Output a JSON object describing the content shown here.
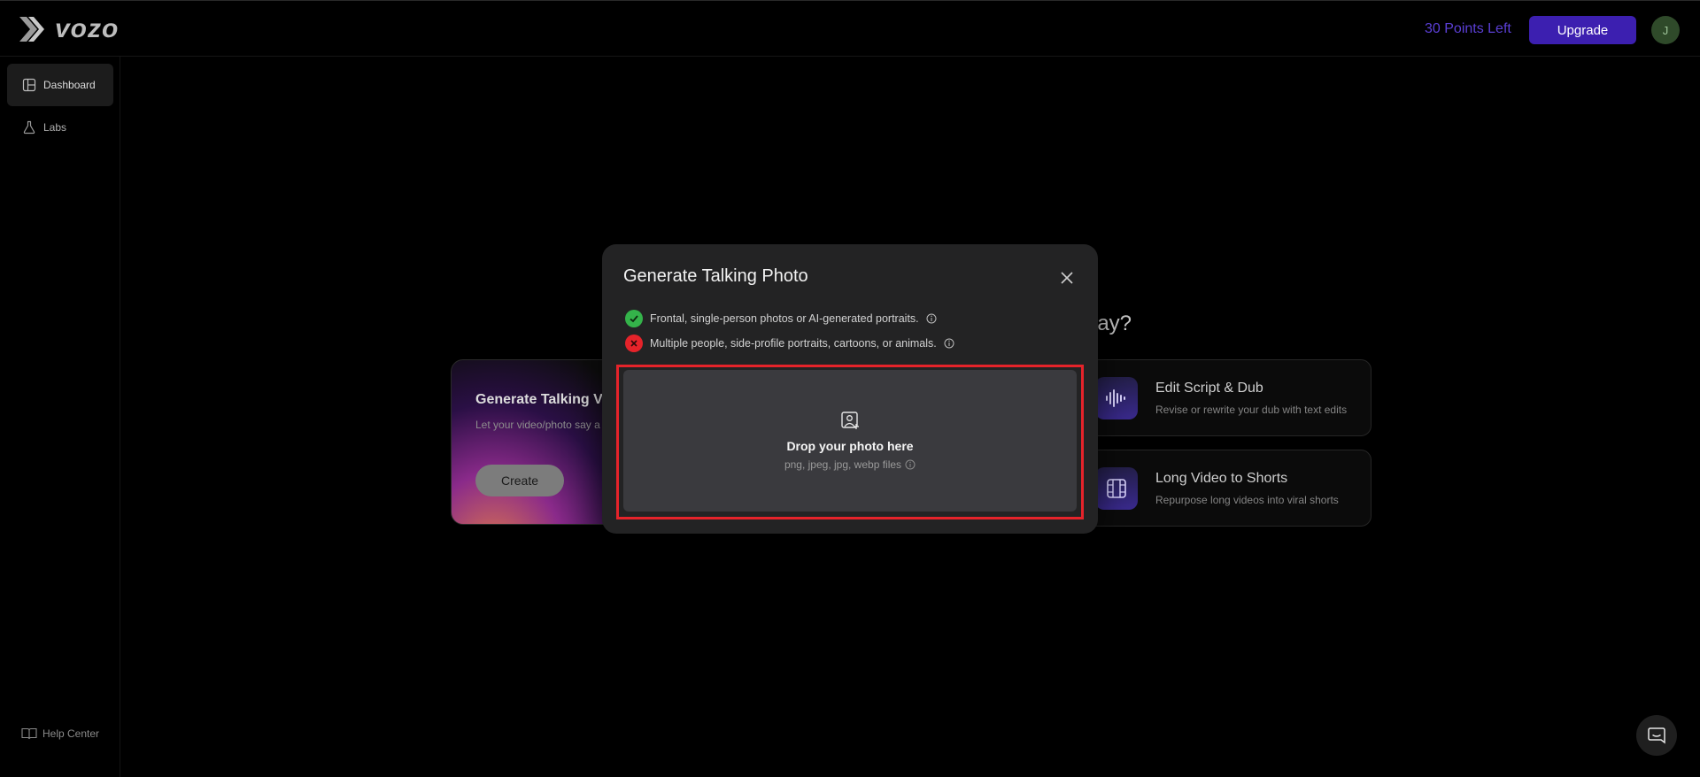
{
  "brand": {
    "name": "vozo"
  },
  "header": {
    "points_label": "30 Points Left",
    "upgrade_label": "Upgrade",
    "avatar_initial": "J"
  },
  "sidebar": {
    "items": [
      {
        "label": "Dashboard",
        "icon": "dashboard-icon",
        "active": true
      },
      {
        "label": "Labs",
        "icon": "flask-icon",
        "active": false
      }
    ],
    "help_label": "Help Center"
  },
  "background": {
    "heading_fragment": "lay?",
    "feature_card": {
      "title": "Generate Talking V",
      "subtitle": "Let your video/photo say a",
      "button_label": "Create"
    },
    "tools": [
      {
        "title": "Edit Script & Dub",
        "subtitle": "Revise or rewrite your dub with text edits",
        "icon": "waveform-icon"
      },
      {
        "title": "Long Video to Shorts",
        "subtitle": "Repurpose long videos into viral shorts",
        "icon": "film-icon"
      }
    ]
  },
  "modal": {
    "title": "Generate Talking Photo",
    "rules": [
      {
        "text": "Frontal, single-person photos or AI-generated portraits.",
        "status": "allowed",
        "color": "#34b34a"
      },
      {
        "text": "Multiple people, side-profile portraits, cartoons, or animals.",
        "status": "not-allowed",
        "color": "#e5232a"
      }
    ],
    "dropzone": {
      "title": "Drop your photo here",
      "formats": "png, jpeg, jpg, webp files"
    }
  },
  "colors": {
    "accent": "#3c1fb0",
    "points": "#5b3fd6",
    "highlight": "#e5232a"
  }
}
